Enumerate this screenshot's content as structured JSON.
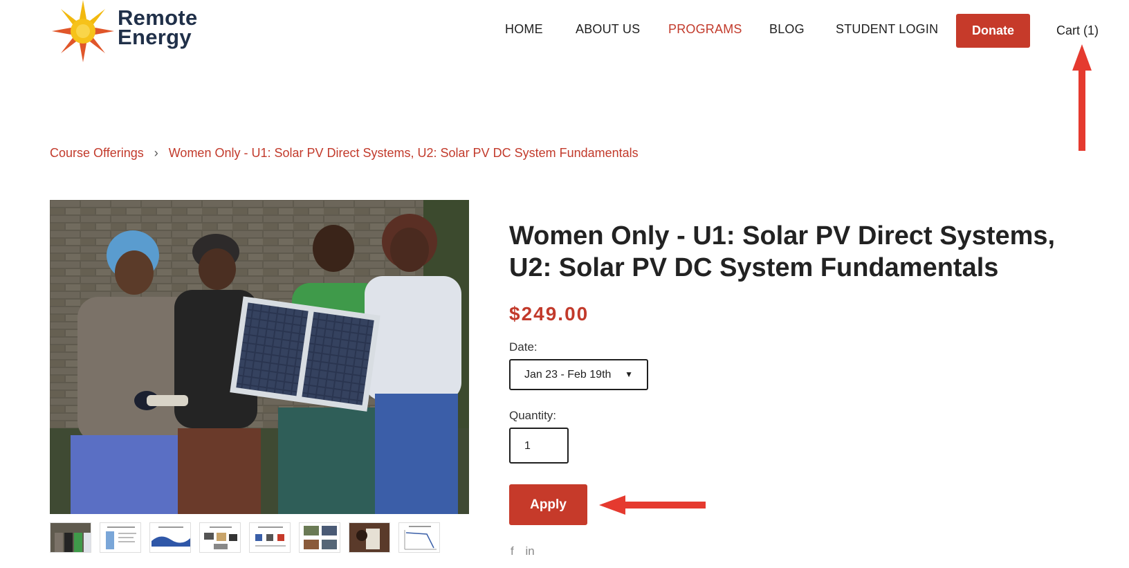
{
  "brand": {
    "line1": "Remote",
    "line2": "Energy"
  },
  "nav": {
    "items": [
      {
        "label": "HOME",
        "active": false
      },
      {
        "label": "ABOUT US",
        "active": false
      },
      {
        "label": "PROGRAMS",
        "active": true
      },
      {
        "label": "BLOG",
        "active": false
      },
      {
        "label": "STUDENT LOGIN",
        "active": false
      }
    ],
    "donate_label": "Donate",
    "cart_label": "Cart (1)"
  },
  "breadcrumb": {
    "items": [
      "Course Offerings",
      "Women Only - U1: Solar PV Direct Systems, U2: Solar PV DC System Fundamentals"
    ],
    "separator": "›"
  },
  "product": {
    "title": "Women Only - U1: Solar PV Direct Systems, U2: Solar PV DC System Fundamentals",
    "price": "$249.00",
    "date_label": "Date:",
    "date_value": "Jan 23 - Feb 19th",
    "quantity_label": "Quantity:",
    "quantity_value": "1",
    "apply_label": "Apply"
  },
  "share": {
    "icons": [
      "facebook-icon",
      "linkedin-icon"
    ],
    "facebook_glyph": "f",
    "linkedin_glyph": "in"
  },
  "colors": {
    "accent": "#c63a2a",
    "link": "#c23a2b",
    "annotation_arrow": "#e53a2f",
    "brand_navy": "#203049"
  }
}
